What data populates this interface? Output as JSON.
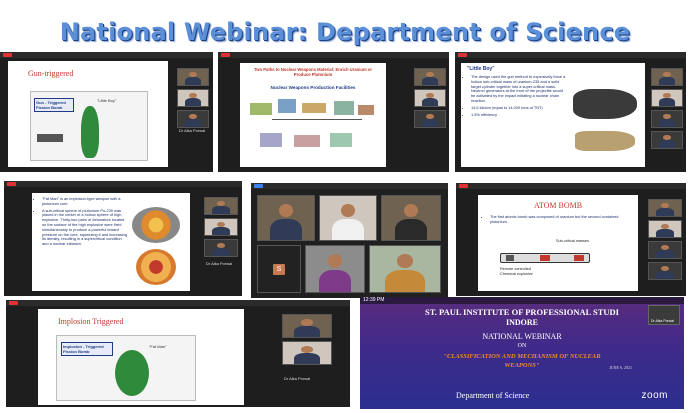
{
  "title": "National Webinar: Department of Science",
  "panels": [
    {
      "id": "gun-triggered",
      "slide_title": "Gun-triggered",
      "box_label": "Gun - Triggered Fission Bomb",
      "little_boy_label": "\"Little Boy\"",
      "participant_name": "Dr Alka Porwal"
    },
    {
      "id": "two-paths",
      "slide_title": "Two Paths to Nuclear Weapons Material: Enrich Uranium or Produce Plutonium",
      "subtitle": "Nuclear Weapons Production Facilities"
    },
    {
      "id": "little-boy",
      "slide_title": "\"Little Boy\"",
      "bullets": [
        "The design used the gun method to explosively force a hollow sub-critical mass of uranium-235 and a solid target cylinder together into a super-critical mass. Neutron generators at the front of the projectile would be activated by the impact initiating a nuclear chain reaction.",
        "14.5 kiloton (equal to 14,000 tons of TNT)",
        "1.5% efficiency"
      ]
    },
    {
      "id": "fat-man",
      "bullets": [
        "\"Fat Man\" is an implosion-type weapon with a plutonium core.",
        "A sub-critical sphere of plutonium Pu-239 was placed in the center of a hollow sphere of high explosive. Thirty-two pairs of detonators located on the surface of the high explosive were fired simultaneously to produce a powerful inward pressure on the core, squeezing it and increasing its density, resulting in a supercritical condition and a nuclear initiation."
      ],
      "participant_name": "Dr Alka Porwal"
    },
    {
      "id": "atom-bomb",
      "slide_title": "ATOM BOMB",
      "bullet": "The first atomic bomb was composed of uranium but the second contained plutonium.",
      "label_subcritical": "Sub-critical masses",
      "label_remote": "Remote controlled Chemical explosive"
    },
    {
      "id": "implosion-triggered",
      "slide_title": "Implosion Triggered",
      "box_label": "Implosion - Triggered Fission Bomb",
      "fat_man_label": "\"Fat Man\"",
      "participant_name": "Dr Alka Porwal"
    }
  ],
  "gallery": {
    "participant_initial": "S"
  },
  "banner": {
    "time": "12:39 PM",
    "institute_line1": "ST. PAUL INSTITUTE OF PROFESSIONAL STUDI",
    "institute_line2": "INDORE",
    "webinar_label": "NATIONAL WEBINAR",
    "on_label": "ON",
    "talk_title_line1": "\"CLASSIFICATION AND MECHANISM OF NUCLEAR",
    "talk_title_line2": "WEAPONS\"",
    "date": "JUNE 6, 2021",
    "department": "Department of Science",
    "zoom_logo": "zoom",
    "mini_name": "Dr Alka Porwal"
  },
  "colors": {
    "title_blue": "#5b8fd8",
    "slide_red": "#c0392b",
    "banner_orange": "#f28c28"
  }
}
